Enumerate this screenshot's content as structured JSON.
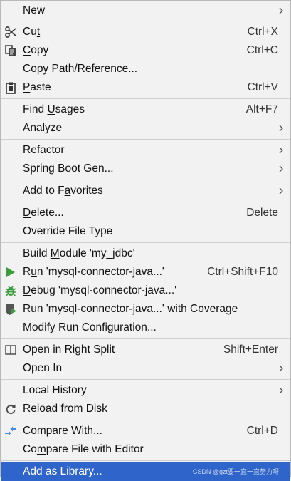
{
  "menu": {
    "new": "New",
    "cut": {
      "pre": "Cu",
      "u": "t",
      "post": "",
      "shortcut": "Ctrl+X"
    },
    "copy": {
      "pre": "",
      "u": "C",
      "post": "opy",
      "shortcut": "Ctrl+C"
    },
    "copy_path": "Copy Path/Reference...",
    "paste": {
      "pre": "",
      "u": "P",
      "post": "aste",
      "shortcut": "Ctrl+V"
    },
    "find_usages": {
      "pre": "Find ",
      "u": "U",
      "post": "sages",
      "shortcut": "Alt+F7"
    },
    "analyze": {
      "pre": "Analy",
      "u": "z",
      "post": "e"
    },
    "refactor": {
      "pre": "",
      "u": "R",
      "post": "efactor"
    },
    "spring_boot": "Spring Boot Gen...",
    "add_favorites": {
      "pre": "Add to F",
      "u": "a",
      "post": "vorites"
    },
    "delete": {
      "pre": "",
      "u": "D",
      "post": "elete...",
      "shortcut": "Delete"
    },
    "override": "Override File Type",
    "build_module": {
      "pre": "Build ",
      "u": "M",
      "post": "odule 'my_jdbc'"
    },
    "run": {
      "pre": "R",
      "u": "u",
      "post": "n 'mysql-connector-java...'",
      "shortcut": "Ctrl+Shift+F10"
    },
    "debug": {
      "pre": "",
      "u": "D",
      "post": "ebug 'mysql-connector-java...'"
    },
    "run_coverage": {
      "pre": "Run 'mysql-connector-java...' with Co",
      "u": "v",
      "post": "erage"
    },
    "modify_run": "Modify Run Configuration...",
    "open_right_split": {
      "label": "Open in Right Split",
      "shortcut": "Shift+Enter"
    },
    "open_in": "Open In",
    "local_history": {
      "pre": "Local ",
      "u": "H",
      "post": "istory"
    },
    "reload": "Reload from Disk",
    "compare_with": {
      "label": "Compare With...",
      "shortcut": "Ctrl+D"
    },
    "compare_file": {
      "pre": "Co",
      "u": "m",
      "post": "pare File with Editor"
    },
    "add_library": "Add as Library..."
  },
  "watermark": "CSDN @gzt要一直一直努力呀",
  "colors": {
    "accent": "#2f65ca",
    "run_green": "#3c9b3c",
    "compare_blue": "#3f8bdc"
  },
  "icons": [
    "scissors-icon",
    "copy-icon",
    "clipboard-icon",
    "run-icon",
    "bug-icon",
    "coverage-icon",
    "split-icon",
    "reload-icon",
    "compare-icon"
  ]
}
